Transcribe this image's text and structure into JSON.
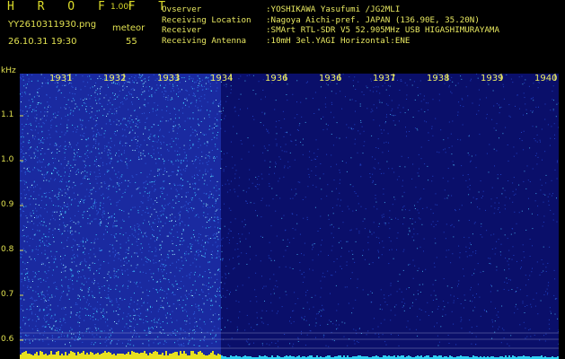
{
  "app": {
    "title": "H R O F F T",
    "version": "1.00f",
    "filename": "YY2610311930.png",
    "datetime": "26.10.31 19:30",
    "mode": "meteor",
    "count": "55"
  },
  "info": [
    {
      "key": "Ovserver",
      "value": ":YOSHIKAWA Yasufumi /JG2MLI"
    },
    {
      "key": "Receiving Location",
      "value": ":Nagoya Aichi-pref. JAPAN (136.90E, 35.20N)"
    },
    {
      "key": "Receiver",
      "value": ":SMArt RTL-SDR V5 52.905MHz USB HIGASHIMURAYAMA"
    },
    {
      "key": "Receiving Antenna",
      "value": ":10mH 3el.YAGI Horizontal:ENE"
    }
  ],
  "axis": {
    "unit": "kHz",
    "y_ticks": [
      "1.1",
      "1.0",
      "0.9",
      "0.8",
      "0.7",
      "0.6"
    ],
    "x_ticks": [
      "1931",
      "1932",
      "1933",
      "1934",
      "1936",
      "1936",
      "1937",
      "1938",
      "1939",
      "1940"
    ]
  },
  "colors": {
    "label": "#e0e050",
    "bg_active": "#1a2aa0",
    "bg_quiet": "#0a0f6a",
    "speckle": "#40d0ff",
    "bottom_bar_active": "#e8e020",
    "bottom_bar_quiet": "#30d0f0"
  }
}
